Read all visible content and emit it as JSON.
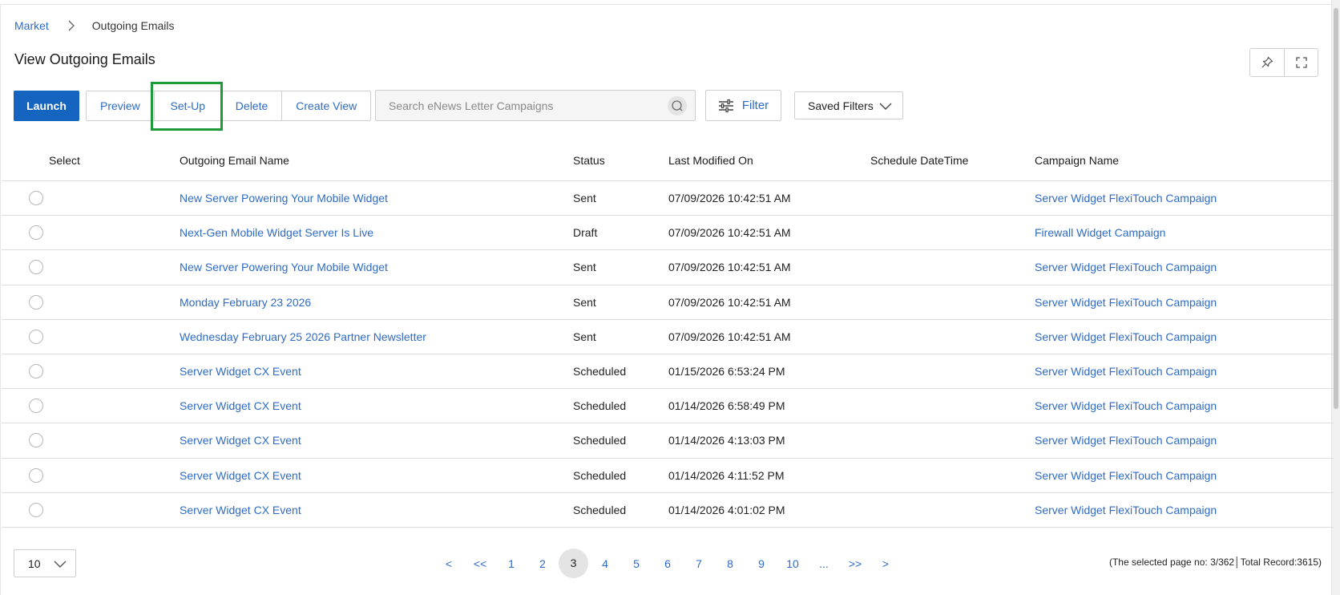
{
  "breadcrumb": {
    "parent": "Market",
    "current": "Outgoing Emails"
  },
  "page": {
    "title": "View Outgoing Emails"
  },
  "toolbar": {
    "launch": "Launch",
    "preview": "Preview",
    "setup": "Set-Up",
    "delete": "Delete",
    "create_view": "Create View",
    "search_placeholder": "Search eNews Letter Campaigns",
    "filter": "Filter",
    "saved_filters": "Saved Filters"
  },
  "table": {
    "headers": {
      "select": "Select",
      "name": "Outgoing Email Name",
      "status": "Status",
      "modified": "Last Modified On",
      "schedule": "Schedule DateTime",
      "campaign": "Campaign Name"
    },
    "rows": [
      {
        "name": "New Server Powering Your Mobile Widget",
        "status": "Sent",
        "modified": "07/09/2026 10:42:51 AM",
        "schedule": "",
        "campaign": "Server Widget FlexiTouch Campaign"
      },
      {
        "name": "Next-Gen Mobile Widget Server Is Live",
        "status": "Draft",
        "modified": "07/09/2026 10:42:51 AM",
        "schedule": "",
        "campaign": "Firewall Widget Campaign"
      },
      {
        "name": "New Server Powering Your Mobile Widget",
        "status": "Sent",
        "modified": "07/09/2026 10:42:51 AM",
        "schedule": "",
        "campaign": "Server Widget FlexiTouch Campaign"
      },
      {
        "name": "Monday February 23 2026",
        "status": "Sent",
        "modified": "07/09/2026 10:42:51 AM",
        "schedule": "",
        "campaign": "Server Widget FlexiTouch Campaign"
      },
      {
        "name": "Wednesday February 25 2026 Partner Newsletter",
        "status": "Sent",
        "modified": "07/09/2026 10:42:51 AM",
        "schedule": "",
        "campaign": "Server Widget FlexiTouch Campaign"
      },
      {
        "name": "Server Widget CX Event",
        "status": "Scheduled",
        "modified": "01/15/2026 6:53:24 PM",
        "schedule": "",
        "campaign": "Server Widget FlexiTouch Campaign"
      },
      {
        "name": "Server Widget CX Event",
        "status": "Scheduled",
        "modified": "01/14/2026 6:58:49 PM",
        "schedule": "",
        "campaign": "Server Widget FlexiTouch Campaign"
      },
      {
        "name": "Server Widget CX Event",
        "status": "Scheduled",
        "modified": "01/14/2026 4:13:03 PM",
        "schedule": "",
        "campaign": "Server Widget FlexiTouch Campaign"
      },
      {
        "name": "Server Widget CX Event",
        "status": "Scheduled",
        "modified": "01/14/2026 4:11:52 PM",
        "schedule": "",
        "campaign": "Server Widget FlexiTouch Campaign"
      },
      {
        "name": "Server Widget CX Event",
        "status": "Scheduled",
        "modified": "01/14/2026 4:01:02 PM",
        "schedule": "",
        "campaign": "Server Widget FlexiTouch Campaign"
      }
    ]
  },
  "pagination": {
    "page_size": "10",
    "prev": "<",
    "first": "<<",
    "pages": [
      "1",
      "2",
      "3",
      "4",
      "5",
      "6",
      "7",
      "8",
      "9",
      "10"
    ],
    "ellipsis": "...",
    "last": ">>",
    "next": ">",
    "current": "3",
    "info": "(The selected page no: 3/362│Total Record:3615)"
  },
  "colors": {
    "primary": "#1565c0",
    "link": "#2e6bc6",
    "highlight": "#1f9a3a"
  },
  "icons": {
    "breadcrumb_separator": "chevron-right-icon",
    "pin": "pin-icon",
    "fullscreen": "expand-icon",
    "search": "search-icon",
    "filter": "sliders-icon",
    "dropdown": "chevron-down-icon",
    "row_select": "radio-button"
  }
}
